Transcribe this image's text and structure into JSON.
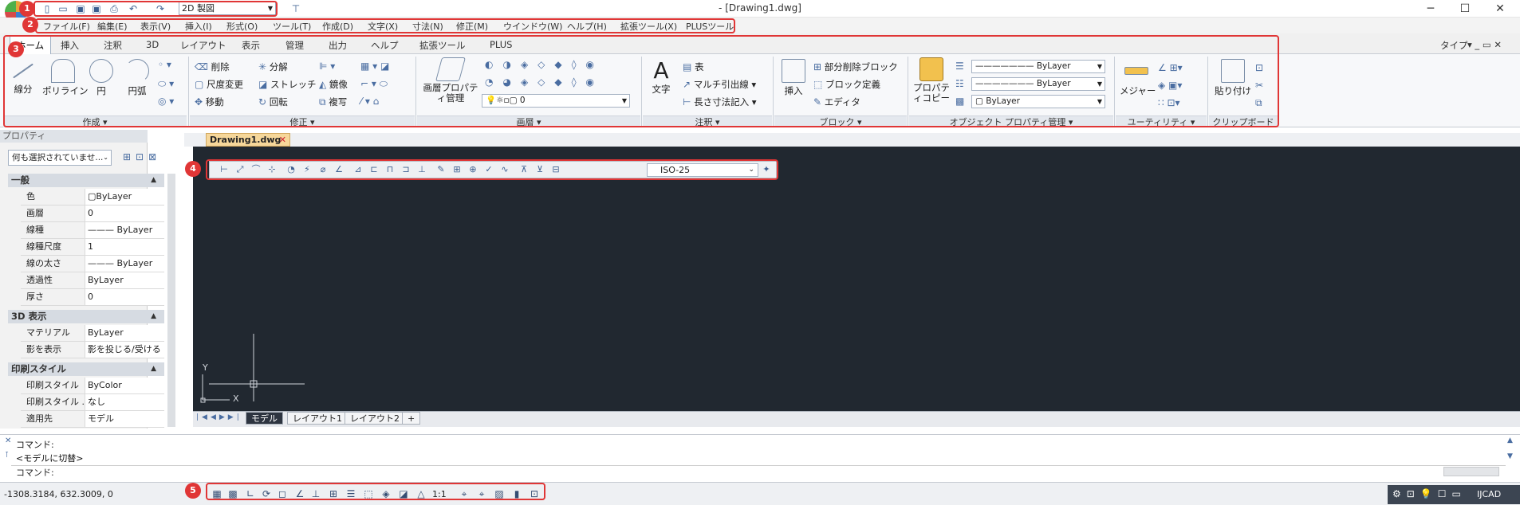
{
  "window": {
    "title": "- [Drawing1.dwg]",
    "workspace": "2D 製図",
    "controls": [
      "─",
      "☐",
      "✕"
    ]
  },
  "menu": [
    "ファイル(F)",
    "編集(E)",
    "表示(V)",
    "挿入(I)",
    "形式(O)",
    "ツール(T)",
    "作成(D)",
    "文字(X)",
    "寸法(N)",
    "修正(M)",
    "ウインドウ(W)",
    "ヘルプ(H)",
    "拡張ツール(X)",
    "PLUSツール"
  ],
  "ribbon_tabs": [
    "ホーム",
    "挿入",
    "注釈",
    "3D",
    "レイアウト",
    "表示",
    "管理",
    "出力",
    "ヘルプ",
    "拡張ツール",
    "PLUS"
  ],
  "ribbon_right": "タイプ",
  "panels": {
    "draw": {
      "label": "作成",
      "buttons": [
        "線分",
        "ポリライン",
        "円",
        "円弧"
      ]
    },
    "modify": {
      "label": "修正",
      "items": [
        "削除",
        "分解",
        "尺度変更",
        "ストレッチ",
        "鏡像",
        "移動",
        "回転",
        "複写"
      ]
    },
    "layers": {
      "label": "画層",
      "big": "画層プロパティ管理",
      "layer_value": "0"
    },
    "annotation": {
      "label": "注釈",
      "big": "文字",
      "items": [
        "表",
        "マルチ引出線",
        "長さ寸法記入"
      ]
    },
    "block": {
      "label": "ブロック",
      "big": "挿入",
      "items": [
        "部分削除ブロック",
        "ブロック定義",
        "エディタ"
      ]
    },
    "properties": {
      "label": "オブジェクト プロパティ管理",
      "big": "プロパティコピー",
      "values": [
        "ByLayer",
        "ByLayer",
        "ByLayer"
      ]
    },
    "utilities": {
      "label": "ユーティリティ",
      "big": "メジャー"
    },
    "clipboard": {
      "label": "クリップボード",
      "big": "貼り付け"
    }
  },
  "properties_palette": {
    "title": "プロパティ",
    "selection": "何も選択されていませ...",
    "sections": [
      {
        "name": "一般",
        "rows": [
          [
            "色",
            "ByLayer"
          ],
          [
            "画層",
            "0"
          ],
          [
            "線種",
            "——— ByLayer"
          ],
          [
            "線種尺度",
            "1"
          ],
          [
            "線の太さ",
            "——— ByLayer"
          ],
          [
            "透過性",
            "ByLayer"
          ],
          [
            "厚さ",
            "0"
          ]
        ]
      },
      {
        "name": "3D 表示",
        "rows": [
          [
            "マテリアル",
            "ByLayer"
          ],
          [
            "影を表示",
            "影を投じる/受ける"
          ]
        ]
      },
      {
        "name": "印刷スタイル",
        "rows": [
          [
            "印刷スタイル",
            "ByColor"
          ],
          [
            "印刷スタイル ...",
            "なし"
          ],
          [
            "適用先",
            "モデル"
          ]
        ]
      }
    ]
  },
  "document": {
    "tab": "Drawing1.dwg",
    "layout_tabs": [
      "モデル",
      "レイアウト1",
      "レイアウト2"
    ],
    "axis_x": "X",
    "axis_y": "Y"
  },
  "dim_toolbar": {
    "style": "ISO-25"
  },
  "command": {
    "lines": [
      "コマンド:",
      "<モデルに切替>"
    ],
    "prompt": "コマンド:"
  },
  "status": {
    "coords": "-1308.3184, 632.3009, 0",
    "scale": "1:1",
    "brand": "IJCAD"
  },
  "annotations": [
    "1",
    "2",
    "3",
    "4",
    "5"
  ],
  "colors": {
    "annotation": "#e03636",
    "canvas": "#212830"
  }
}
